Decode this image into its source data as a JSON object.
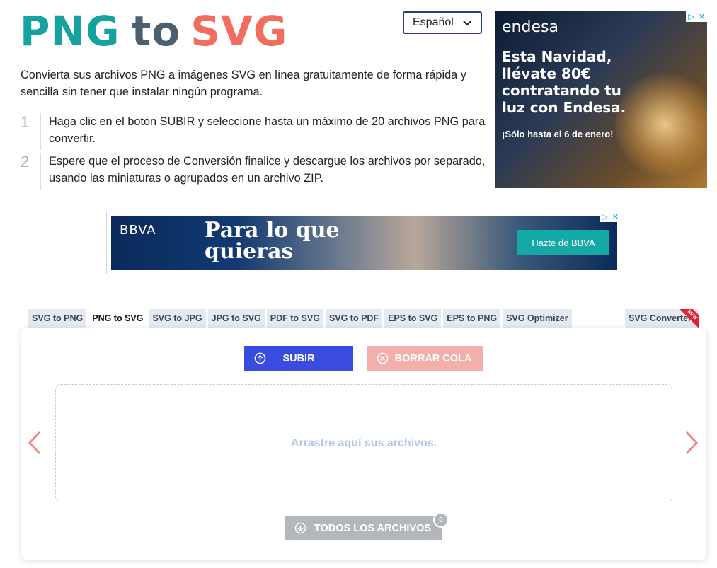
{
  "logo": {
    "part1": "PNG",
    "part2": "to",
    "part3": "SVG"
  },
  "language": {
    "selected": "Español"
  },
  "intro": "Convierta sus archivos PNG a imágenes SVG en línea gratuitamente de forma rápida y sencilla sin tener que instalar ningún programa.",
  "steps": [
    {
      "num": "1",
      "text": "Haga clic en el botón SUBIR y seleccione hasta un máximo de 20 archivos PNG para convertir."
    },
    {
      "num": "2",
      "text": "Espere que el proceso de Conversión finalice y descargue los archivos por separado, usando las miniaturas o agrupados en un archivo ZIP."
    }
  ],
  "ad_side": {
    "brand": "endesa",
    "headline": "Esta Navidad, llévate 80€ contratando tu luz con Endesa.",
    "subline": "¡Sólo hasta el 6 de enero!"
  },
  "ad_banner": {
    "brand": "BBVA",
    "headline_line1": "Para lo que",
    "headline_line2": "quieras",
    "cta": "Hazte de BBVA"
  },
  "tabs": [
    {
      "label": "SVG to PNG"
    },
    {
      "label": "PNG to SVG"
    },
    {
      "label": "SVG to JPG"
    },
    {
      "label": "JPG to SVG"
    },
    {
      "label": "PDF to SVG"
    },
    {
      "label": "SVG to PDF"
    },
    {
      "label": "EPS to SVG"
    },
    {
      "label": "EPS to PNG"
    },
    {
      "label": "SVG Optimizer"
    }
  ],
  "tab_right": {
    "label": "SVG Converter",
    "badge": "NEW"
  },
  "buttons": {
    "upload": "SUBIR",
    "clear": "BORRAR COLA",
    "all_files": "TODOS LOS ARCHIVOS"
  },
  "dropzone": {
    "text": "Arrastre aquí sus archivos."
  },
  "file_count": "0",
  "colors": {
    "teal": "#16a3a0",
    "slate": "#4b5f6e",
    "coral": "#f26d5e",
    "primary": "#3a4be0"
  }
}
